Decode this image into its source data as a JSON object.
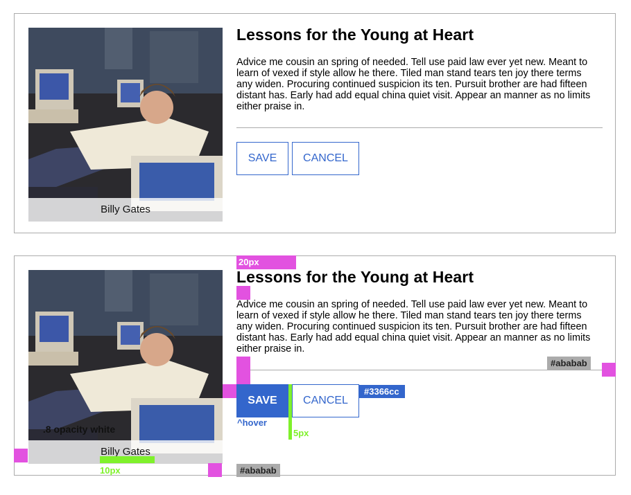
{
  "colors": {
    "accent": "#3366cc",
    "border": "#ababab",
    "margin_marker": "#e252e0",
    "gap_marker": "#7ff12b",
    "caption_bg": "rgba(255,255,255,0.8)"
  },
  "card1": {
    "image_caption": "Billy Gates",
    "title": "Lessons for the Young at Heart",
    "body": "Advice me cousin an spring of needed. Tell use paid law ever yet new. Meant to learn of vexed if style allow he there. Tiled man stand tears ten joy there terms any widen. Procuring continued suspicion its ten. Pursuit brother are had fifteen distant has. Early had add equal china quiet visit. Appear an manner as no limits either praise in.",
    "save_label": "SAVE",
    "cancel_label": "CANCEL"
  },
  "card2": {
    "image_caption": "Billy Gates",
    "title": "Lessons for the Young at Heart",
    "body": "Advice me cousin an spring of needed. Tell use paid law ever yet new. Meant to learn of vexed if style allow he there. Tiled man stand tears ten joy there terms any widen. Procuring continued suspicion its ten. Pursuit brother are had fifteen distant has. Early had add equal china quiet visit. Appear an manner as no limits either praise in.",
    "save_label": "SAVE",
    "cancel_label": "CANCEL"
  },
  "annotations": {
    "top_margin": "20px",
    "divider_color": "#ababab",
    "button_color": "#3366cc",
    "hover": "^hover",
    "button_gap": "5px",
    "caption_opacity": ".8 opacity white",
    "caption_padding": "10px",
    "border_color": "#ababab"
  }
}
